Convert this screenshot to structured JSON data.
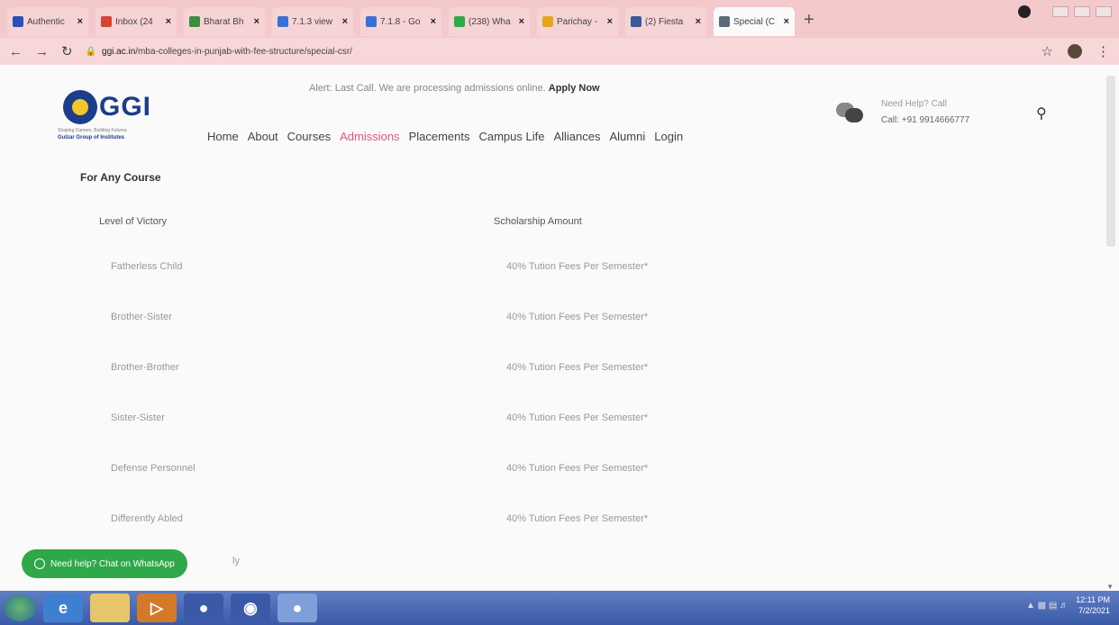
{
  "browser": {
    "tabs": [
      {
        "title": "Authentic",
        "color": "#2e4fb5",
        "active": false
      },
      {
        "title": "Inbox (24",
        "color": "#d64532",
        "active": false
      },
      {
        "title": "Bharat Bh",
        "color": "#3e8e41",
        "active": false
      },
      {
        "title": "7.1.3 view",
        "color": "#3c6fd6",
        "active": false
      },
      {
        "title": "7.1.8 - Go",
        "color": "#3c6fd6",
        "active": false
      },
      {
        "title": "(238) Wha",
        "color": "#2fa84a",
        "active": false
      },
      {
        "title": "Parichay -",
        "color": "#e3a81d",
        "active": false
      },
      {
        "title": "(2) Fiesta",
        "color": "#3b5998",
        "active": false
      },
      {
        "title": "Special (C",
        "color": "#5a6a7a",
        "active": true
      }
    ],
    "new_tab": "+",
    "url_domain": "ggi.ac.in",
    "url_path": "/mba-colleges-in-punjab-with-fee-structure/special-csr/"
  },
  "site": {
    "logo": {
      "word": "GGI",
      "tagline": "Shaping Careers. Building Futures.",
      "subtitle": "Gulzar Group of Institutes"
    },
    "alert_text": "Alert: Last Call. We are processing admissions online.",
    "alert_link": "Apply Now",
    "nav": [
      "Home",
      "About",
      "Courses",
      "Admissions",
      "Placements",
      "Campus Life",
      "Alliances",
      "Alumni",
      "Login"
    ],
    "active_nav": "Admissions",
    "help_line1": "Need Help? Call",
    "help_line2": "Call: +91 9914666777"
  },
  "content": {
    "section_title": "For Any Course",
    "headers": [
      "Level of Victory",
      "Scholarship Amount"
    ],
    "rows": [
      {
        "category": "Fatherless Child",
        "amount": "40% Tution Fees Per Semester*"
      },
      {
        "category": "Brother-Sister",
        "amount": "40% Tution Fees Per Semester*"
      },
      {
        "category": "Brother-Brother",
        "amount": "40% Tution Fees Per Semester*"
      },
      {
        "category": "Sister-Sister",
        "amount": "40% Tution Fees Per Semester*"
      },
      {
        "category": "Defense Personnel",
        "amount": "40% Tution Fees Per Semester*"
      },
      {
        "category": "Differently Abled",
        "amount": "40% Tution Fees Per Semester*"
      }
    ],
    "partial_row_tail": "ly"
  },
  "whatsapp_label": "Need help? Chat on WhatsApp",
  "taskbar": {
    "time": "12:11 PM",
    "date": "7/2/2021"
  }
}
